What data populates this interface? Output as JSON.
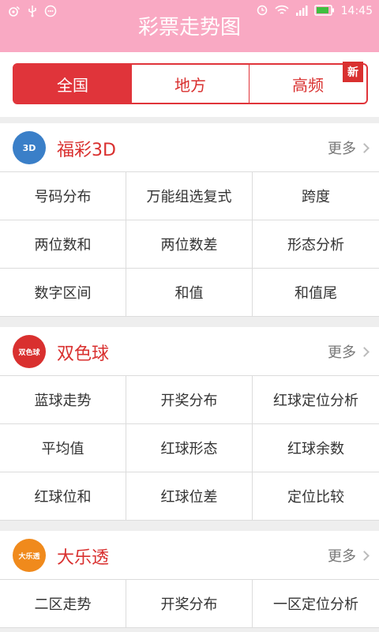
{
  "status_bar": {
    "time": "14:45",
    "icons": [
      "weibo-icon",
      "usb-icon",
      "message-icon",
      "alarm-icon",
      "wifi-icon",
      "signal-icon",
      "battery-icon"
    ]
  },
  "header": {
    "title": "彩票走势图"
  },
  "tabs": [
    {
      "label": "全国",
      "active": true
    },
    {
      "label": "地方",
      "active": false
    },
    {
      "label": "高频",
      "active": false,
      "badge": "新"
    }
  ],
  "sections": [
    {
      "title": "福彩3D",
      "logo_text": "3D",
      "logo_color": "#3a7fc8",
      "more_label": "更多",
      "items": [
        "号码分布",
        "万能组选复式",
        "跨度",
        "两位数和",
        "两位数差",
        "形态分析",
        "数字区间",
        "和值",
        "和值尾"
      ]
    },
    {
      "title": "双色球",
      "logo_text": "双色球",
      "logo_color": "#d9302f",
      "more_label": "更多",
      "items": [
        "蓝球走势",
        "开奖分布",
        "红球定位分析",
        "平均值",
        "红球形态",
        "红球余数",
        "红球位和",
        "红球位差",
        "定位比较"
      ]
    },
    {
      "title": "大乐透",
      "logo_text": "大乐透",
      "logo_color": "#f08a1c",
      "more_label": "更多",
      "items": [
        "二区走势",
        "开奖分布",
        "一区定位分析"
      ]
    }
  ],
  "colors": {
    "header_bg": "#f9a9c3",
    "accent": "#e0343a"
  }
}
